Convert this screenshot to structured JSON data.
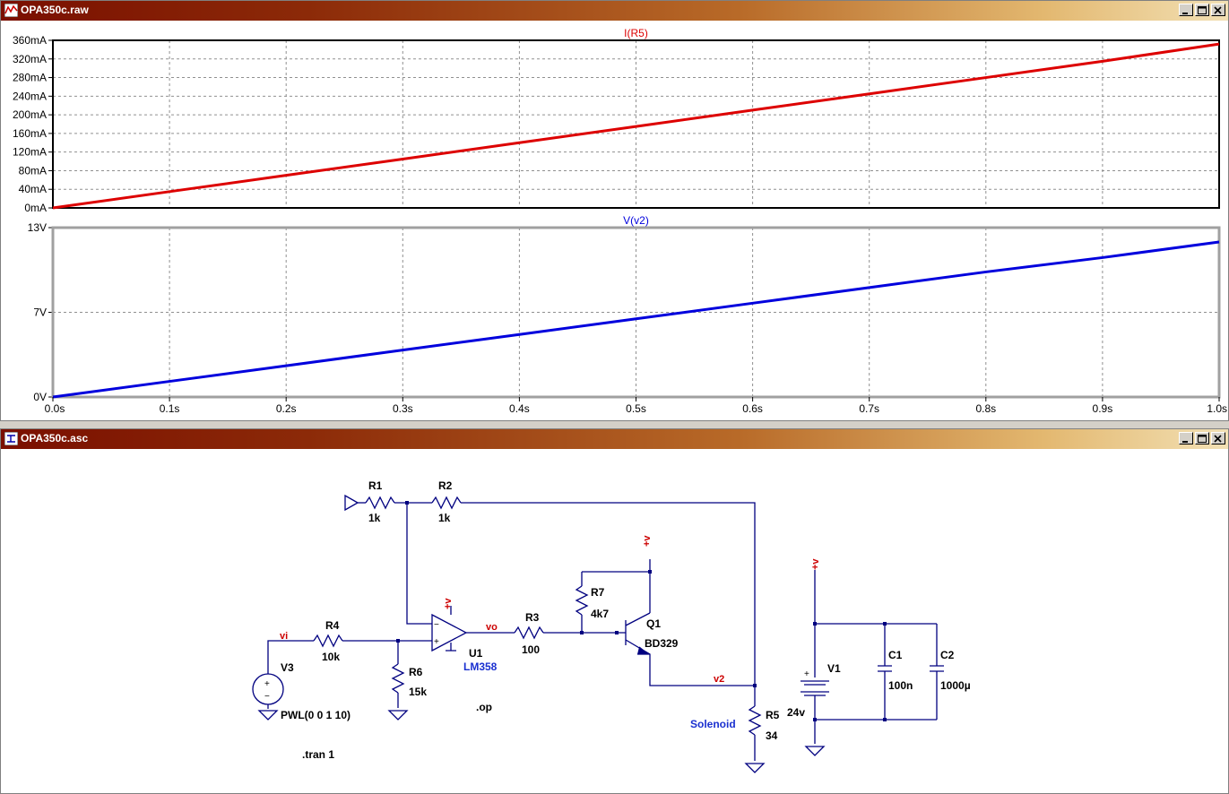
{
  "plot_window": {
    "title": "OPA350c.raw",
    "chart_data": [
      {
        "type": "line",
        "title": "I(R5)",
        "x": [
          0.0,
          0.1,
          0.2,
          0.3,
          0.4,
          0.5,
          0.6,
          0.7,
          0.8,
          0.9,
          1.0
        ],
        "series": [
          {
            "name": "I(R5)",
            "values": [
              0,
              35,
              70,
              105,
              140,
              175,
              210,
              245,
              280,
              315,
              352
            ]
          }
        ],
        "ylim": [
          0,
          360
        ],
        "yticks": [
          "0mA",
          "40mA",
          "80mA",
          "120mA",
          "160mA",
          "200mA",
          "240mA",
          "280mA",
          "320mA",
          "360mA"
        ],
        "color": "#dd0000",
        "grid": true
      },
      {
        "type": "line",
        "title": "V(v2)",
        "x": [
          0.0,
          0.1,
          0.2,
          0.3,
          0.4,
          0.5,
          0.6,
          0.7,
          0.8,
          0.9,
          1.0
        ],
        "series": [
          {
            "name": "V(v2)",
            "values": [
              0,
              1.2,
              2.4,
              3.6,
              4.8,
              6.0,
              7.2,
              8.4,
              9.6,
              10.7,
              11.9
            ]
          }
        ],
        "ylim": [
          0,
          13
        ],
        "yticks": [
          "0V",
          "7V",
          "13V"
        ],
        "color": "#0000dd",
        "grid": true
      }
    ],
    "xticks": [
      "0.0s",
      "0.1s",
      "0.2s",
      "0.3s",
      "0.4s",
      "0.5s",
      "0.6s",
      "0.7s",
      "0.8s",
      "0.9s",
      "1.0s"
    ]
  },
  "schematic_window": {
    "title": "OPA350c.asc",
    "labels": {
      "r1": "R1",
      "r1_val": "1k",
      "r2": "R2",
      "r2_val": "1k",
      "r3": "R3",
      "r3_val": "100",
      "r4": "R4",
      "r4_val": "10k",
      "r5": "R5",
      "r5_val": "34",
      "r6": "R6",
      "r6_val": "15k",
      "r7": "R7",
      "r7_val": "4k7",
      "q1": "Q1",
      "q1_val": "BD329",
      "u1": "U1",
      "u1_val": "LM358",
      "v1": "V1",
      "v1_val": "24v",
      "v3": "V3",
      "v3_val": "PWL(0 0 1 10)",
      "c1": "C1",
      "c1_val": "100n",
      "c2": "C2",
      "c2_val": "1000µ",
      "net_vi": "vi",
      "net_vo": "vo",
      "net_v2": "v2",
      "plus_v": "+v",
      "solenoid": "Solenoid",
      "op": ".op",
      "tran": ".tran 1",
      "plus": "+",
      "minus": "−"
    }
  },
  "colors": {
    "net_label": "#cc0000",
    "part_blue": "#1a30d0",
    "wire": "#000080",
    "grid": "#808080"
  }
}
